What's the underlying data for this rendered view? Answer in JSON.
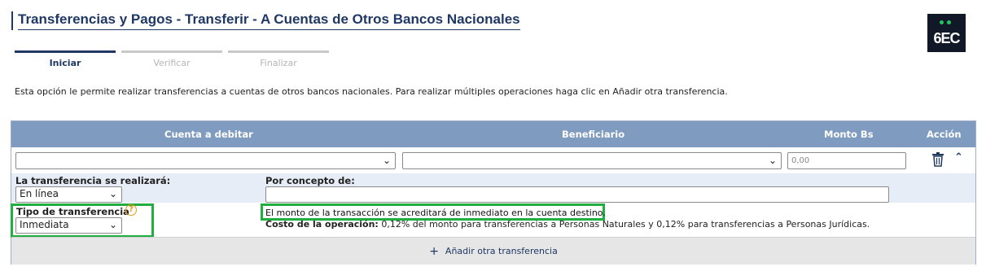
{
  "header": {
    "title": "Transferencias y Pagos - Transferir - A Cuentas de Otros Bancos Nacionales",
    "logo_text": "6EC"
  },
  "steps": [
    {
      "label": "Iniciar"
    },
    {
      "label": "Verificar"
    },
    {
      "label": "Finalizar"
    }
  ],
  "intro_text": "Esta opción le permite realizar transferencias a cuentas de otros bancos nacionales. Para realizar múltiples operaciones haga clic en Añadir otra transferencia.",
  "table": {
    "columns": {
      "account": "Cuenta a debitar",
      "beneficiary": "Beneficiario",
      "amount": "Monto Bs",
      "action": "Acción"
    },
    "row": {
      "account_value": "",
      "beneficiary_value": "",
      "amount_placeholder": "0,00"
    }
  },
  "form": {
    "when_label": "La transferencia se realizará:",
    "when_value": "En línea",
    "concept_label": "Por concepto de:",
    "concept_value": "",
    "type_label": "Tipo de transferencia",
    "type_value": "Inmediata",
    "help_glyph": "?",
    "notice": "El monto de la transacción se acreditará de inmediato en la cuenta destino.",
    "cost_label": "Costo de la operación:",
    "cost_text": "0,12% del monto para transferencias a Personas Naturales y 0,12% para transferencias a Personas Jurídicas."
  },
  "add_transfer": {
    "icon": "plus-icon",
    "label": "Añadir otra transferencia"
  },
  "colors": {
    "brand": "#1f3864",
    "header_bar": "#7f9cc0",
    "highlight": "#1fae3f",
    "help": "#e39b1c"
  }
}
